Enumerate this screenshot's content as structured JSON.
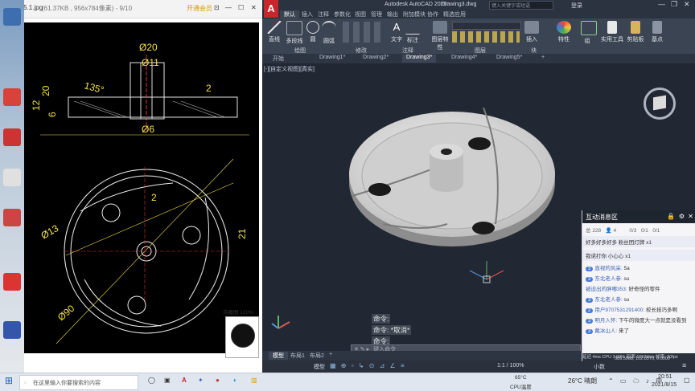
{
  "viewer": {
    "title": "8.15.1.jpg",
    "meta": "(61.37KB , 956x784像素) - 9/10",
    "tag": "开通会员",
    "thumb_label": "鸟瞰图 120%"
  },
  "drawing": {
    "dims": [
      "Ø20",
      "Ø11",
      "135°",
      "2",
      "20",
      "12",
      "6",
      "Ø6",
      "2",
      "Ø13",
      "21",
      "Ø90"
    ]
  },
  "taskbar": {
    "search_placeholder": "在这里输入你要搜索的内容",
    "weather_temp": "26°C 晴朗",
    "cpu_temp": "65°C",
    "cpu_label": "CPU温度",
    "time": "20:51",
    "date": "2021/8/15"
  },
  "acad": {
    "app_title": "Autodesk AutoCAD 2020",
    "doc_title": "Drawing3.dwg",
    "search_placeholder": "键入关键字或短语",
    "login": "登录",
    "ribbon_tabs": [
      "默认",
      "插入",
      "注释",
      "参数化",
      "视图",
      "管理",
      "输出",
      "附加模块",
      "协作",
      "精选应用"
    ],
    "ribbon_buttons": [
      "直线",
      "多段线",
      "圆",
      "圆弧",
      "文字",
      "标注",
      "图层特性",
      "插入",
      "特性",
      "组",
      "实用工具",
      "剪贴板",
      "基点"
    ],
    "panel_titles": [
      "绘图",
      "修改",
      "注释",
      "图层",
      "块"
    ],
    "doc_tabs": [
      "开始",
      "Drawing1*",
      "Drawing2*",
      "Drawing3*",
      "Drawing4*",
      "Drawing5*"
    ],
    "view_label": "[-][自定义视图][真实]",
    "command_lines": [
      "命令:",
      "命令: *取消*",
      "命令:"
    ],
    "command_placeholder": "键入命令",
    "layout_tabs": [
      "模型",
      "布局1",
      "布局2"
    ],
    "status_model": "模型",
    "status_scale": "1:1 / 100%",
    "status_units": "小数",
    "coords": "389.5968, 102.8570, 0.0000"
  },
  "chat": {
    "title": "互动消息区",
    "stats": [
      "228",
      "4",
      "0/3",
      "0/1",
      "0/1"
    ],
    "gift_rows": [
      "好多好多好多 粉丝团灯牌 x1",
      "我诺打你 小心心 x1"
    ],
    "messages": [
      {
        "level": "3",
        "name": "直视的风采:",
        "text": "5a"
      },
      {
        "level": "3",
        "name": "东北老人参:",
        "text": "su"
      },
      {
        "level": "",
        "name": "被迫出的胖嘟353:",
        "text": "好奇怪的零件"
      },
      {
        "level": "3",
        "name": "东北老人参:",
        "text": "su"
      },
      {
        "level": "2",
        "name": "用户9707531291400:",
        "text": "校长技巧多啊"
      },
      {
        "level": "3",
        "name": "明月入怀:",
        "text": "下午的微度大一点就是没看到"
      },
      {
        "level": "3",
        "name": "戴冰山人:",
        "text": "来了"
      }
    ],
    "footer": [
      "延迟 4ms",
      "CPU 3.09%",
      "码率:1652kb/s",
      "帧率: 30fps"
    ]
  }
}
